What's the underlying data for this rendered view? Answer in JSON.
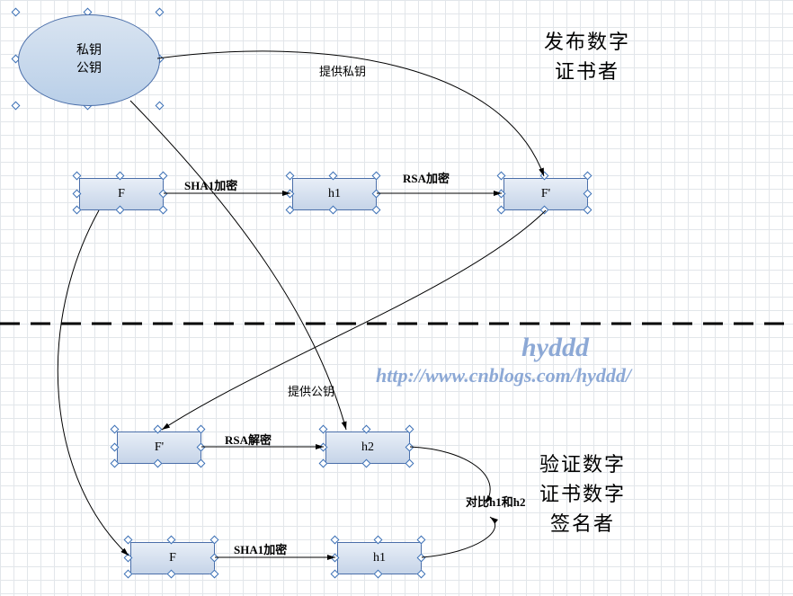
{
  "diagram": {
    "ellipse": {
      "line1": "私钥",
      "line2": "公钥"
    },
    "topRow": {
      "box1": "F",
      "box2": "h1",
      "box3": "F'"
    },
    "bottom": {
      "boxFprime": "F'",
      "boxH2": "h2",
      "boxF": "F",
      "boxH1": "h1"
    },
    "labels": {
      "providePrivate": "提供私钥",
      "sha1Encrypt": "SHA1加密",
      "rsaEncrypt": "RSA加密",
      "providePublic": "提供公钥",
      "rsaDecrypt": "RSA解密",
      "compare": "对比h1和h2",
      "sha1Encrypt2": "SHA1加密"
    },
    "titles": {
      "publisherL1": "发布数字",
      "publisherL2": "证书者",
      "verifierL1": "验证数字",
      "verifierL2": "证书数字",
      "verifierL3": "签名者"
    },
    "watermark": {
      "name": "hyddd",
      "url": "http://www.cnblogs.com/hyddd/"
    }
  }
}
